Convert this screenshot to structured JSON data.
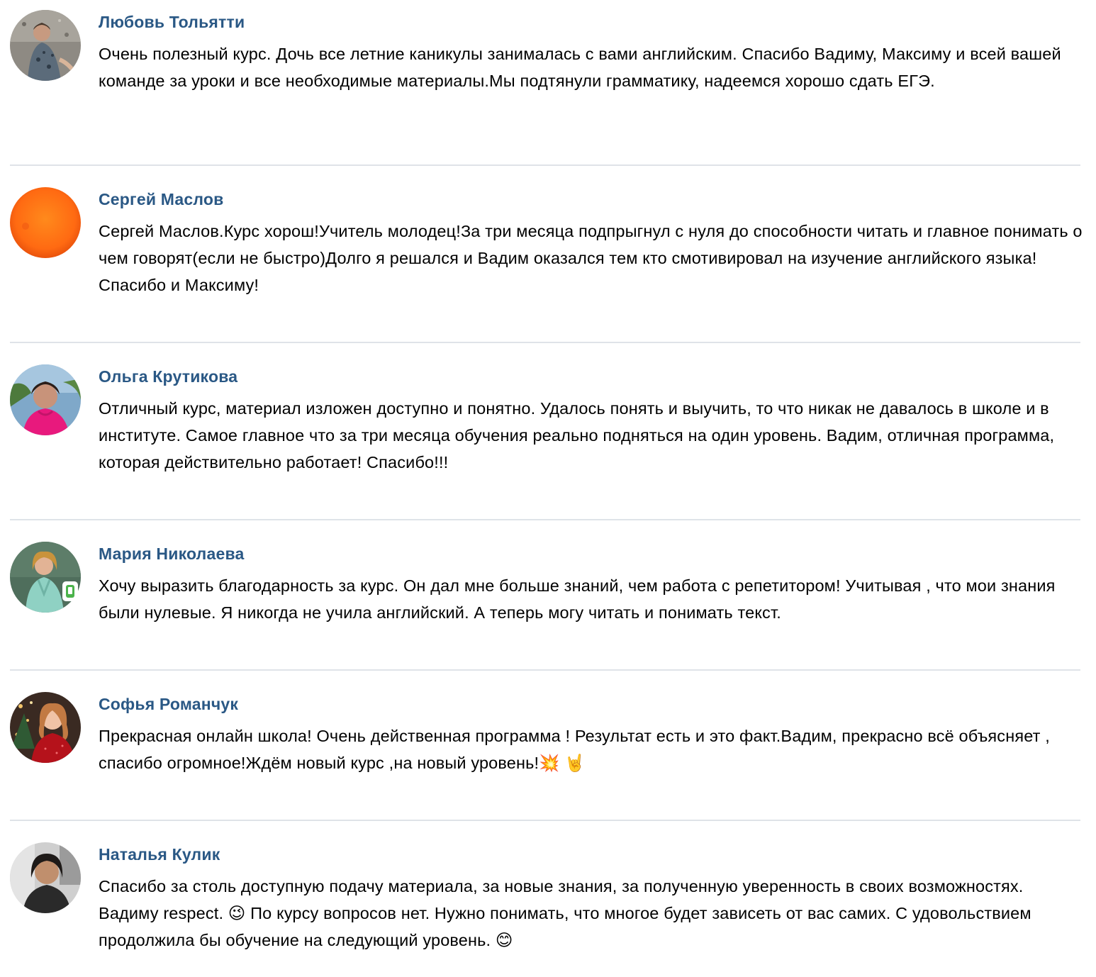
{
  "comments": [
    {
      "author": "Любовь Тольятти",
      "text": "Очень полезный курс. Дочь все летние каникулы занималась с вами английским. Спасибо Вадиму, Максиму и всей вашей команде за уроки и все необходимые материалы.Мы подтянули грамматику, надеемся хорошо сдать ЕГЭ."
    },
    {
      "author": "Сергей Маслов",
      "text": "Сергей Маслов.Курс хорош!Учитель молодец!За три месяца подпрыгнул с нуля до способности читать и главное понимать о чем говорят(если не быстро)Долго я решался и Вадим оказался тем кто смотивировал на изучение английского языка!Спасибо и Максиму!"
    },
    {
      "author": "Ольга Крутикова",
      "text": "Отличный курс, материал изложен доступно и понятно. Удалось понять и выучить, то что никак не давалось в школе и в институте. Самое главное что за три месяца обучения реально подняться на один уровень. Вадим, отличная программа, которая действительно работает! Спасибо!!!"
    },
    {
      "author": "Мария Николаева",
      "text": "Хочу выразить благодарность за курс. Он дал мне больше знаний, чем работа с репетитором! Учитывая , что мои знания были нулевые. Я никогда не учила английский. А теперь могу читать и понимать текст.",
      "mobile_icon": "mobile-phone-icon"
    },
    {
      "author": "Софья Романчук",
      "text": "Прекрасная онлайн школа! Очень действенная программа ! Результат есть и это факт.Вадим, прекрасно всё объясняет , спасибо огромное!Ждём новый курс ,на новый уровень!💥 🤘"
    },
    {
      "author": "Наталья Кулик",
      "text": "Спасибо за столь доступную подачу материала, за новые знания, за полученную уверенность в своих возможностях. Вадиму respect. 😉 По курсу вопросов нет. Нужно понимать, что многое будет зависеть от вас самих. С удовольствием продолжила бы обучение на следующий уровень. 😊"
    }
  ],
  "colors": {
    "author_link": "#2a5885",
    "text": "#000000",
    "divider": "#dfe3e8",
    "online_mobile": "#4bb34b"
  }
}
